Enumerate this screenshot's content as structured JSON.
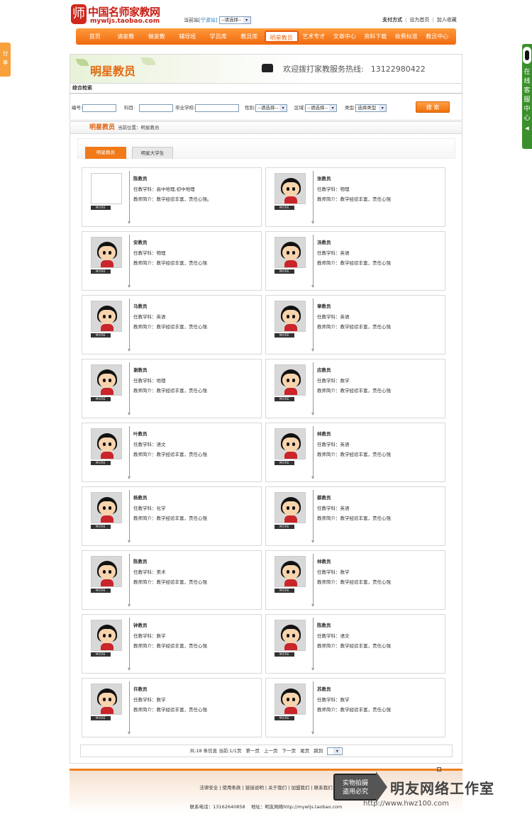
{
  "header": {
    "logo_text": "中国名师家教网",
    "logo_url": "mywljs.taobao.com",
    "logo_seal_char": "师",
    "station_label": "当前站",
    "station_city": "[宁波站]",
    "station_select": "--请选择--",
    "links": [
      "支付方式",
      "设为首页",
      "加入收藏"
    ]
  },
  "nav": {
    "items": [
      "首页",
      "请家教",
      "做家教",
      "辅导班",
      "学员库",
      "教员库",
      "明星教员",
      "艺术专才",
      "文章中心",
      "资料下载",
      "收费标准",
      "教员中心"
    ],
    "active_index": 6
  },
  "side": {
    "share_label": "分享",
    "kefu_chars": [
      "在",
      "线",
      "客",
      "服",
      "中",
      "心"
    ]
  },
  "banner": {
    "title": "明星教员",
    "hotline_label": "欢迎拨打家教服务热线:",
    "hotline_number": "13122980422"
  },
  "search": {
    "heading": "综合检索",
    "fields": {
      "id_label": "编号:",
      "subject_label": "科目:",
      "school_label": "毕业学校:",
      "gender_label": "性别:",
      "gender_select": "--请选择--",
      "area_label": "区域:",
      "area_select": "--请选择--",
      "type_label": "类型:",
      "type_select": "选择类型"
    },
    "button": "搜 索"
  },
  "breadcrumb": {
    "title": "明星教员",
    "path": "当前位置：明星教员"
  },
  "tabs": [
    "明星教员",
    "明星大学生"
  ],
  "more_label": "MORE",
  "teachers": [
    {
      "name": "陈教员",
      "subject": "任教学科：高中地理,初中地理",
      "intro": "教师简介：教学经验丰富，责任心强。",
      "photo": "blank"
    },
    {
      "name": "张教员",
      "subject": "任教学科：物理",
      "intro": "教师简介：教学经验丰富，责任心强",
      "photo": "avatar"
    },
    {
      "name": "安教员",
      "subject": "任教学科：物理",
      "intro": "教师简介：教学经验丰富，责任心强",
      "photo": "avatar"
    },
    {
      "name": "汤教员",
      "subject": "任教学科：英语",
      "intro": "教师简介：教学经验丰富，责任心强",
      "photo": "avatar"
    },
    {
      "name": "马教员",
      "subject": "任教学科：英语",
      "intro": "教师简介：教学经验丰富，责任心强",
      "photo": "avatar"
    },
    {
      "name": "章教员",
      "subject": "任教学科：英语",
      "intro": "教师简介：教学经验丰富，责任心强",
      "photo": "avatar"
    },
    {
      "name": "谢教员",
      "subject": "任教学科：地理",
      "intro": "教师简介：教学经验丰富，责任心强",
      "photo": "avatar"
    },
    {
      "name": "应教员",
      "subject": "任教学科：数学",
      "intro": "教师简介：教学经验丰富，责任心强",
      "photo": "avatar"
    },
    {
      "name": "叶教员",
      "subject": "任教学科：语文",
      "intro": "教师简介：教学经验丰富，责任心强",
      "photo": "avatar"
    },
    {
      "name": "林教员",
      "subject": "任教学科：英语",
      "intro": "教师简介：教学经验丰富，责任心强",
      "photo": "avatar"
    },
    {
      "name": "杨教员",
      "subject": "任教学科：化学",
      "intro": "教师简介：教学经验丰富，责任心强",
      "photo": "avatar"
    },
    {
      "name": "蔡教员",
      "subject": "任教学科：英语",
      "intro": "教师简介：教学经验丰富，责任心强",
      "photo": "avatar"
    },
    {
      "name": "陈教员",
      "subject": "任教学科：美术",
      "intro": "教师简介：教学经验丰富，责任心强",
      "photo": "avatar"
    },
    {
      "name": "林教员",
      "subject": "任教学科：数学",
      "intro": "教师简介：教学经验丰富，责任心强",
      "photo": "avatar"
    },
    {
      "name": "钟教员",
      "subject": "任教学科：数学",
      "intro": "教师简介：教学经验丰富，责任心强",
      "photo": "avatar"
    },
    {
      "name": "陈教员",
      "subject": "任教学科：语文",
      "intro": "教师简介：教学经验丰富，责任心强",
      "photo": "avatar"
    },
    {
      "name": "许教员",
      "subject": "任教学科：数学",
      "intro": "教师简介：教学经验丰富，责任心强",
      "photo": "avatar"
    },
    {
      "name": "苏教员",
      "subject": "任教学科：数学",
      "intro": "教师简介：教学经验丰富，责任心强",
      "photo": "avatar"
    }
  ],
  "pager": {
    "summary": "共:18 条信息 当前:1/1页",
    "first": "第一页",
    "prev": "上一页",
    "next": "下一页",
    "last": "尾页",
    "jump": "跳到",
    "jump_select": ""
  },
  "footer": {
    "links": "法律安全 | 使用条款 | 链接说明 | 关于我们 | 加盟我们 | 联系我们",
    "phone": "联系电话：13162640858",
    "address": "地址：明友网络http://mywljs.taobao.com"
  },
  "watermark": {
    "badge": [
      "实物拍摄",
      "盗用必究"
    ],
    "brand": "明友网络工作室",
    "url": "http://www.hwz100.com"
  },
  "colors": {
    "accent": "#f07a1a",
    "nav_gradient_top": "#ff9a3a",
    "logo_red": "#c81d13"
  }
}
